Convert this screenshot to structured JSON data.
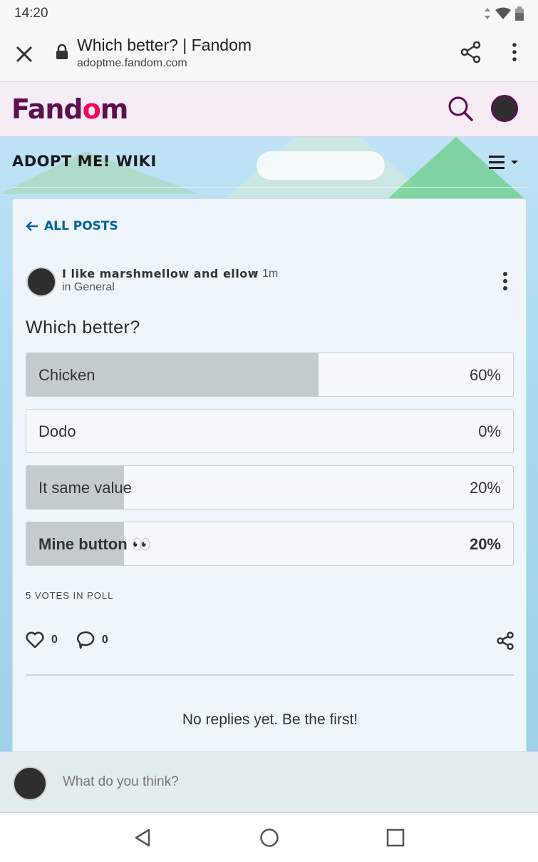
{
  "status_bar": {
    "time": "14:20"
  },
  "browser": {
    "page_title": "Which better? | Fandom",
    "url": "adoptme.fandom.com"
  },
  "fandom": {
    "logo_text_pre": "Fand",
    "logo_text_heart": "o",
    "logo_text_post": "m"
  },
  "wiki": {
    "title": "ADOPT ME! WIKI"
  },
  "post": {
    "back_label": "ALL POSTS",
    "author": "I like marshmellow and ellow",
    "separator": "•",
    "time": "1m",
    "category": "in General",
    "title": "Which better?",
    "poll": [
      {
        "label": "Chicken",
        "percent_text": "60%",
        "fraction": 0.6,
        "selected": false
      },
      {
        "label": "Dodo",
        "percent_text": "0%",
        "fraction": 0.0,
        "selected": false
      },
      {
        "label": "It same value",
        "percent_text": "20%",
        "fraction": 0.2,
        "selected": false
      },
      {
        "label": "Mine button 👀",
        "percent_text": "20%",
        "fraction": 0.2,
        "selected": true
      }
    ],
    "votes_label": "5 VOTES IN POLL",
    "likes": "0",
    "comments": "0",
    "no_replies": "No replies yet. Be the first!"
  },
  "composer": {
    "placeholder": "What do you think?"
  },
  "colors": {
    "fandom_purple": "#5d0f4e",
    "fandom_pink": "#fa005a",
    "link_blue": "#0062a1",
    "poll_fill": "#c3cbcf"
  }
}
